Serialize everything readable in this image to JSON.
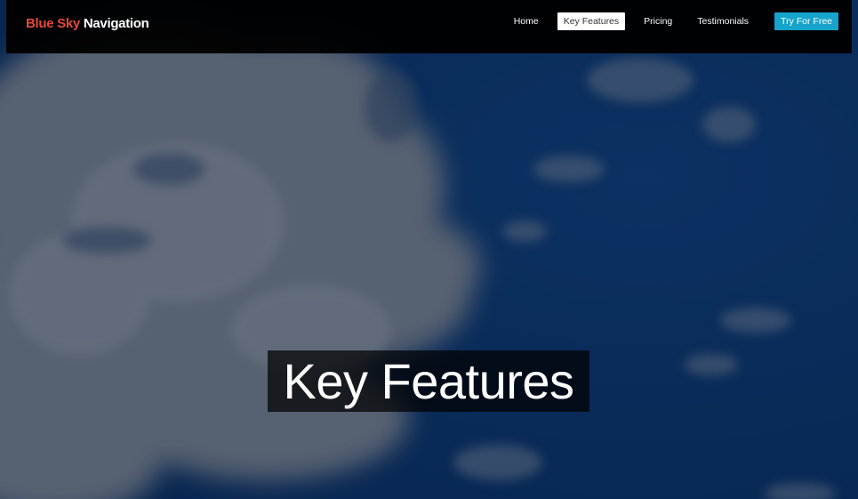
{
  "navbar": {
    "brand_accent": "Blue Sky",
    "brand_main": " Navigation",
    "links": [
      {
        "label": "Home",
        "active": false
      },
      {
        "label": "Key Features",
        "active": true
      },
      {
        "label": "Pricing",
        "active": false
      },
      {
        "label": "Testimonials",
        "active": false
      }
    ],
    "cta_label": "Try For Free"
  },
  "hero": {
    "title": "Key Features",
    "background": "sky-clouds-image"
  },
  "colors": {
    "brand_accent": "#e8473a",
    "cta": "#16a3cc",
    "navbar_bg": "#000000",
    "sky": "#0d3468"
  }
}
